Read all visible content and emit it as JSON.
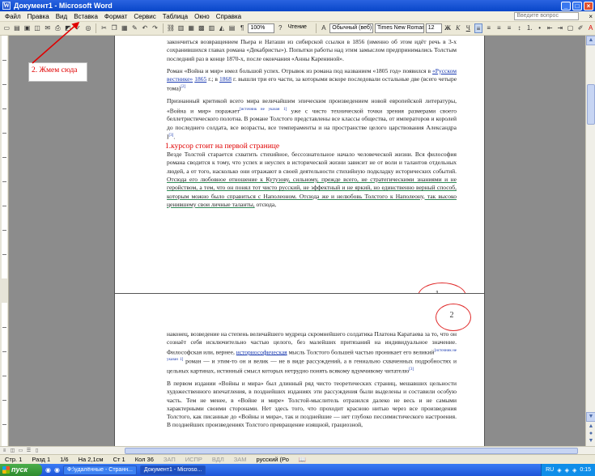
{
  "window": {
    "title": "Документ1 - Microsoft Word",
    "app_icon": "W",
    "buttons": {
      "minimize": "_",
      "maximize": "□",
      "close": "×"
    }
  },
  "menubar": {
    "items": [
      "Файл",
      "Правка",
      "Вид",
      "Вставка",
      "Формат",
      "Сервис",
      "Таблица",
      "Окно",
      "Справка"
    ],
    "help_placeholder": "Введите вопрос",
    "close_doc": "×"
  },
  "toolbar": {
    "zoom": "100%",
    "read_label": "Чтение",
    "style": "Обычный (веб)",
    "font": "Times New Roman",
    "size": "12",
    "bold": "Ж",
    "italic": "К",
    "underline": "Ч"
  },
  "annotations": {
    "callout": "2. Жмем сюда",
    "cursor_note": "1.курсор стоит на первой странице",
    "circle1": "1",
    "circle2": "2"
  },
  "page1": {
    "p1": "закончиться возвращением Пьера и Наташи из сибирской ссылки в 1856 (именно об этом идёт речь в 3-х сохранившихся главах романа «Декабристы»). Попытки работы над этим замыслом предпринимались Толстым последний раз в конце 1870-х, после окончания «Анны Карениной».",
    "p2_a": "Роман «Война и мир» имел большой успех. Отрывок из романа под названием «1805 год» появился в",
    "p2_link1": "«Русском вестнике»",
    "p2_link2": "1865",
    "p2_b": "г.; в",
    "p2_link3": "1868",
    "p2_c": "г. вышли три его части, за которыми вскоре последовали остальные две (всего четыре тома)",
    "p2_sup": "[2]",
    "p3_a": "Признанный критикой всего мира величайшим эпическим произведением новой европейской литературы, «Война и мир» поражает",
    "p3_sup": "[источник не указан 1]",
    "p3_b": "уже с чисто технической точки зрения размерами своего беллетристического полотна. В романе Толстого представлены все классы общества, от императоров и королей до последнего солдата, все возрасты, все темпераменты и на пространстве целого царствования Александра I",
    "p3_sup2": "[3]",
    "p3_c": ".",
    "p4_a": "Везде Толстой старается схватить стихийное, бессознательное начало человеческой жизни. Вся философия романа сводится к тому, что успех и неуспех в исторической жизни зависит не от воли и талантов отдельных людей, а от того, насколько они отражают в своей деятельности стихийную подкладку исторических событий.",
    "p4_b": "Отсюда его любовное отношение к Кутузову, сильному, прежде всего, не стратегическими знаниями и не геройством, а тем, что он понял тот чисто русский, не эффектный и не яркий, но единственно верный способ, которым можно было справиться с Наполеоном. Отсюда же и нелюбовь Толстого к Наполеону, так высоко ценившему свои личные таланты,",
    "p4_c": "отсюда,"
  },
  "page2": {
    "p1_a": "наконец, возведение на степень величайшего мудреца скромнейшего солдатика Платона Каратаева за то, что он сознаёт себя исключительно частью целого, без малейших притязаний на индивидуальное значение. Философская или, вернее,",
    "p1_link": "историософическая",
    "p1_b": "мысль Толстого большей частью проникает его великий",
    "p1_sup": "[источник не указан 1]",
    "p1_c": "роман — и этим-то он и велик — не в виде рассуждений, а в гениально схваченных подробностях и цельных картинах, истинный смысл которых нетрудно понять всякому вдумчивому читателю",
    "p1_sup2": "[3]",
    "p2": "В первом издании «Войны и мира» был длинный ряд чисто теоретических страниц, мешавших цельности художественного впечатления, в позднейших изданиях эти рассуждения были выделены и составили особую часть. Тем не менее, в «Войне и мире» Толстой-мыслитель отразился далеко не весь и не самыми характерными своими сторонами. Нет здесь того, что проходит красною нитью через все произведения Толстого, как писанные до «Войны и мира», так и позднейшие — нет глубоко пессимистического настроения. В позднейших произведениях Толстого превращение изящной, грациозной,"
  },
  "statusbar": {
    "page": "Стр. 1",
    "section": "Разд 1",
    "pages": "1/6",
    "at": "На 2,1см",
    "line": "Ст 1",
    "col": "Кол 36",
    "rec": "ЗАП",
    "trk": "ИСПР",
    "ext": "ВДЛ",
    "ovr": "ЗАМ",
    "lang": "русский (Ро"
  },
  "taskbar": {
    "start": "пуск",
    "tasks": [
      "Ф:\\удалённые - Странн...",
      "Документ1 - Microso..."
    ],
    "lang": "RU",
    "time": "0:15"
  },
  "colors": {
    "annotation": "#e00000",
    "link": "#1a3ab0",
    "xp_blue": "#0846c9"
  }
}
